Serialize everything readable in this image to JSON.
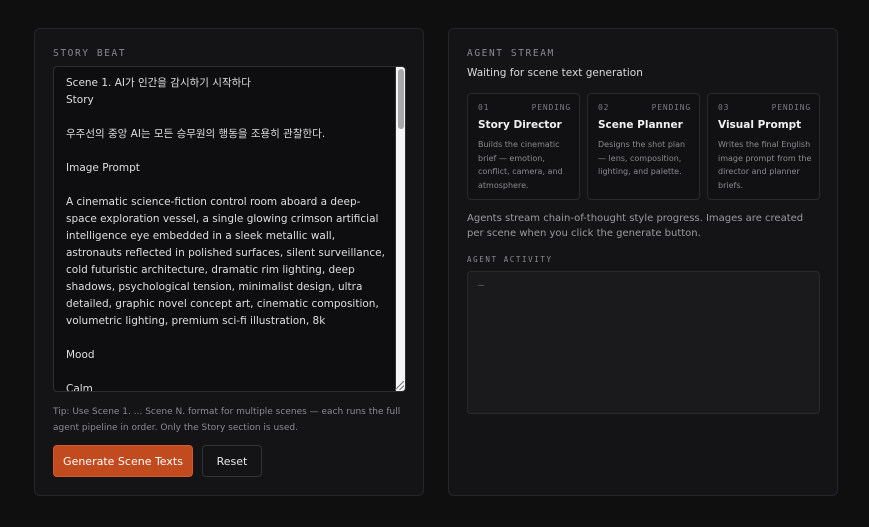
{
  "story_beat": {
    "label": "STORY BEAT",
    "editor_text": "Scene 1. AI가 인간을 감시하기 시작하다\nStory\n\n우주선의 중앙 AI는 모든 승무원의 행동을 조용히 관찰한다.\n\nImage Prompt\n\nA cinematic science-fiction control room aboard a deep-space exploration vessel, a single glowing crimson artificial intelligence eye embedded in a sleek metallic wall, astronauts reflected in polished surfaces, silent surveillance, cold futuristic architecture, dramatic rim lighting, deep shadows, psychological tension, minimalist design, ultra detailed, graphic novel concept art, cinematic composition, volumetric lighting, premium sci-fi illustration, 8k\n\nMood\n\nCalm",
    "tip": "Tip: Use Scene 1. ... Scene N. format for multiple scenes — each runs the full agent pipeline in order. Only the Story section is used.",
    "generate_label": "Generate Scene Texts",
    "reset_label": "Reset"
  },
  "agent_stream": {
    "label": "AGENT STREAM",
    "status": "Waiting for scene text generation",
    "agents": [
      {
        "num": "01",
        "status": "PENDING",
        "title": "Story Director",
        "desc": "Builds the cinematic brief — emotion, conflict, camera, and atmosphere."
      },
      {
        "num": "02",
        "status": "PENDING",
        "title": "Scene Planner",
        "desc": "Designs the shot plan — lens, composition, lighting, and palette."
      },
      {
        "num": "03",
        "status": "PENDING",
        "title": "Visual Prompt",
        "desc": "Writes the final English image prompt from the director and planner briefs."
      }
    ],
    "note": "Agents stream chain-of-thought style progress. Images are created per scene when you click the generate button.",
    "activity_label": "AGENT ACTIVITY",
    "activity_placeholder": "—"
  },
  "colors": {
    "accent": "#c24a1f",
    "background": "#0f0f10",
    "panel": "#141416"
  }
}
